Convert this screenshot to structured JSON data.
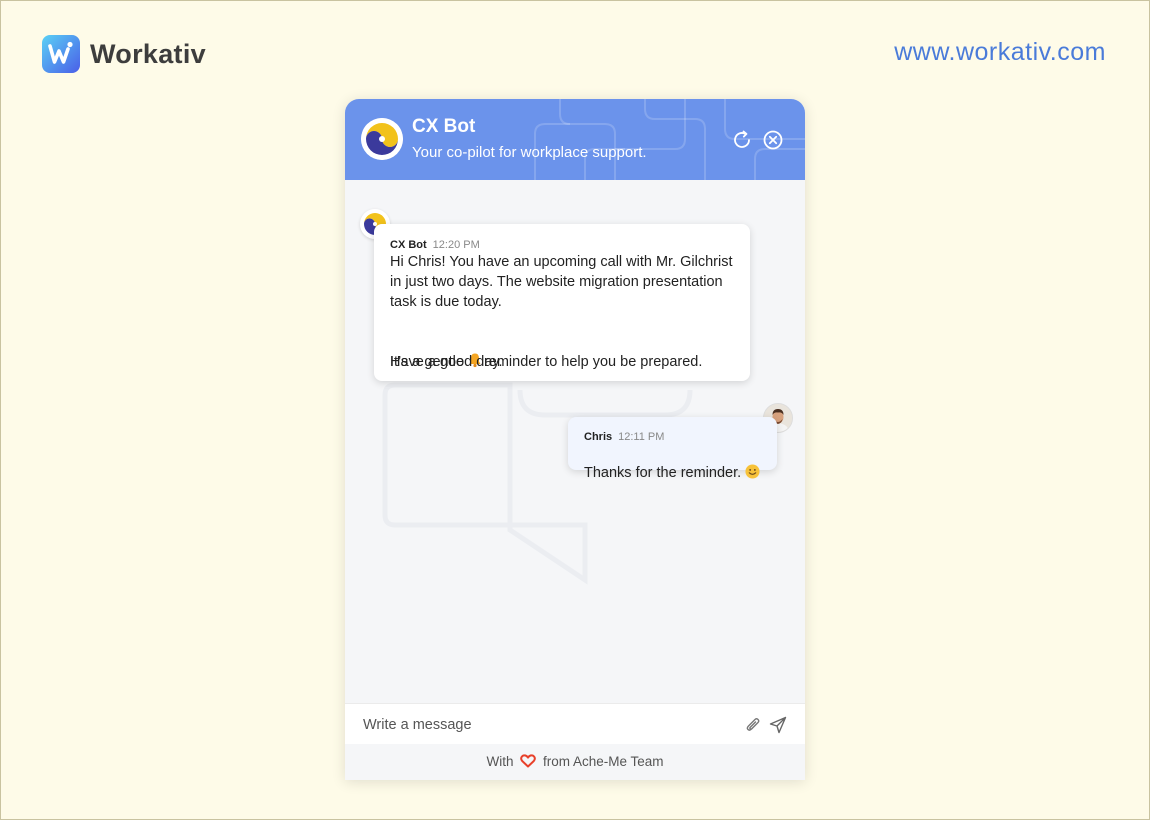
{
  "brand": {
    "name": "Workativ",
    "url": "www.workativ.com",
    "logo_icon": "workativ-logo-icon",
    "accent": "#4a7bd9"
  },
  "widget": {
    "header": {
      "title": "CX Bot",
      "subtitle": "Your co-pilot for workplace support.",
      "refresh_icon": "refresh-icon",
      "close_icon": "close-circle-icon",
      "color": "#6b93eb"
    },
    "messages": [
      {
        "sender": "CX Bot",
        "time": "12:20 PM",
        "line1": "Hi Chris! You have an upcoming call with Mr. Gilchrist",
        "line2": "in just two days. The website migration presentation",
        "line3": "task is due today.",
        "line4a": "It’s a gentle ",
        "line4_icon": "bell-emoji-icon",
        "line4b": "reminder to help you be prepared.",
        "line5": "Have a good day."
      },
      {
        "sender": "Chris",
        "time": "12:11 PM",
        "text": "Thanks for the reminder. ",
        "emoji_icon": "smiley-emoji-icon"
      }
    ],
    "composer": {
      "placeholder": "Write a message",
      "attach_icon": "paperclip-icon",
      "send_icon": "send-icon"
    },
    "footer": {
      "prefix": "With",
      "icon": "heart-icon",
      "suffix": "from Ache-Me Team"
    }
  }
}
